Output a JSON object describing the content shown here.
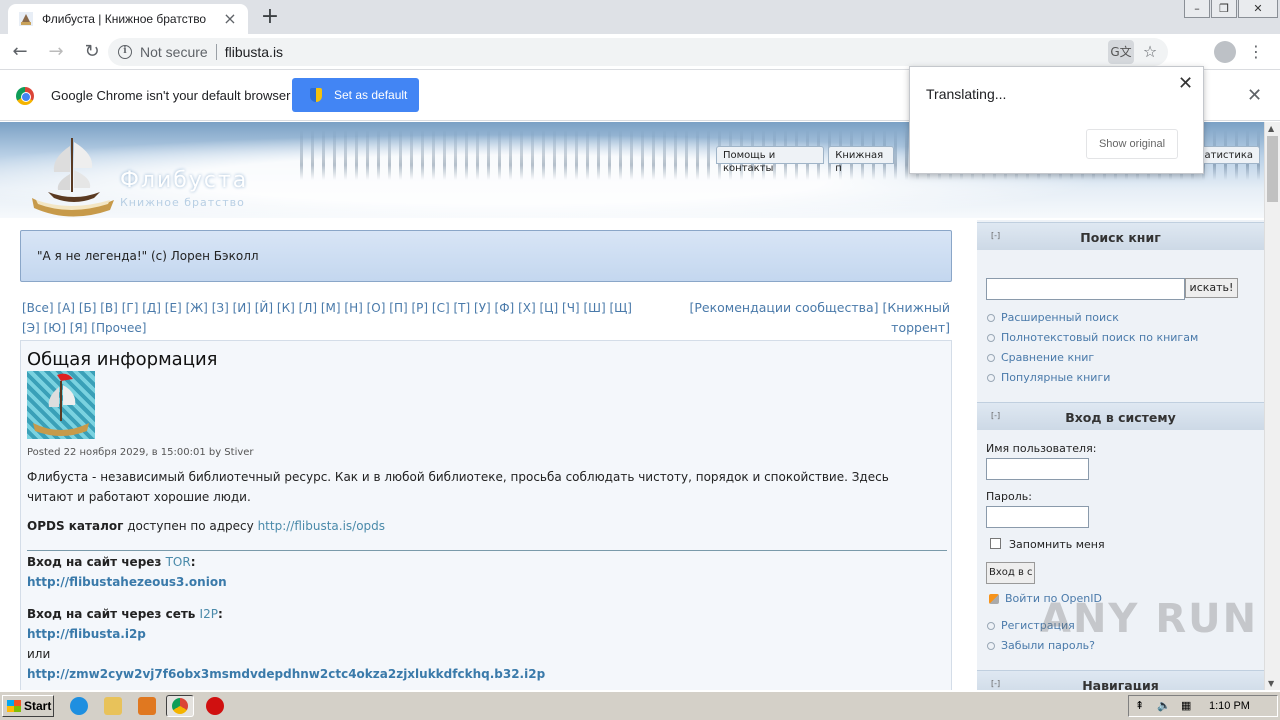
{
  "browser": {
    "tab_title": "Флибуста | Книжное братство",
    "address_security": "Not secure",
    "address_url": "flibusta.is",
    "infobar_message": "Google Chrome isn't your default browser",
    "infobar_button": "Set as default",
    "translate_status": "Translating...",
    "translate_button": "Show original"
  },
  "site": {
    "name": "Флибуста",
    "slogan": "Книжное братство",
    "topnav": [
      "Помощь и контакты",
      "Книжная п",
      "атистика"
    ],
    "quote": "\"А я не легенда!\" (с) Лорен Бэколл",
    "alphabet": [
      "[Все]",
      "[А]",
      "[Б]",
      "[В]",
      "[Г]",
      "[Д]",
      "[Е]",
      "[Ж]",
      "[З]",
      "[И]",
      "[Й]",
      "[К]",
      "[Л]",
      "[М]",
      "[Н]",
      "[О]",
      "[П]",
      "[Р]",
      "[С]",
      "[Т]",
      "[У]",
      "[Ф]",
      "[Х]",
      "[Ц]",
      "[Ч]",
      "[Ш]",
      "[Щ]",
      "[Э]",
      "[Ю]",
      "[Я]",
      "[Прочее]"
    ],
    "recs_link": "[Рекомендации сообщества]",
    "torrent_link": "[Книжный торрент]"
  },
  "article": {
    "title": "Общая информация",
    "posted": "Posted 22 ноября 2029, в 15:00:01 by Stiver",
    "intro": "Флибуста - независимый библиотечный ресурс. Как и в любой библиотеке, просьба соблюдать чистоту, порядок и спокойствие. Здесь читают и работают хорошие люди.",
    "opds_label": "OPDS каталог",
    "opds_text": " доступен по адресу ",
    "opds_url": "http://flibusta.is/opds",
    "tor_label": "Вход на сайт через ",
    "tor_name": "TOR",
    "tor_url": "http://flibustahezeous3.onion",
    "i2p_label": "Вход на сайт через сеть ",
    "i2p_name": "I2P",
    "i2p_url1": "http://flibusta.i2p",
    "or": "или",
    "i2p_url2": "http://zmw2cyw2vj7f6obx3msmdvdepdhnw2ctc4okza2zjxlukkdfckhq.b32.i2p"
  },
  "sidebar": {
    "search_title": "Поиск книг",
    "search_button": "искать!",
    "search_links": [
      "Расширенный поиск",
      "Полнотекстовый поиск по книгам",
      "Сравнение книг",
      "Популярные книги"
    ],
    "login_title": "Вход в систему",
    "username_label": "Имя пользователя:",
    "password_label": "Пароль:",
    "remember_label": "Запомнить меня",
    "login_button": "Вход в с",
    "openid_link": "Войти по OpenID",
    "login_links": [
      "Регистрация",
      "Забыли пароль?"
    ],
    "nav_title": "Навигация",
    "toggle": "[-]"
  },
  "taskbar": {
    "start_label": "Start",
    "clock": "1:10 PM"
  },
  "watermark": "ANY RUN"
}
